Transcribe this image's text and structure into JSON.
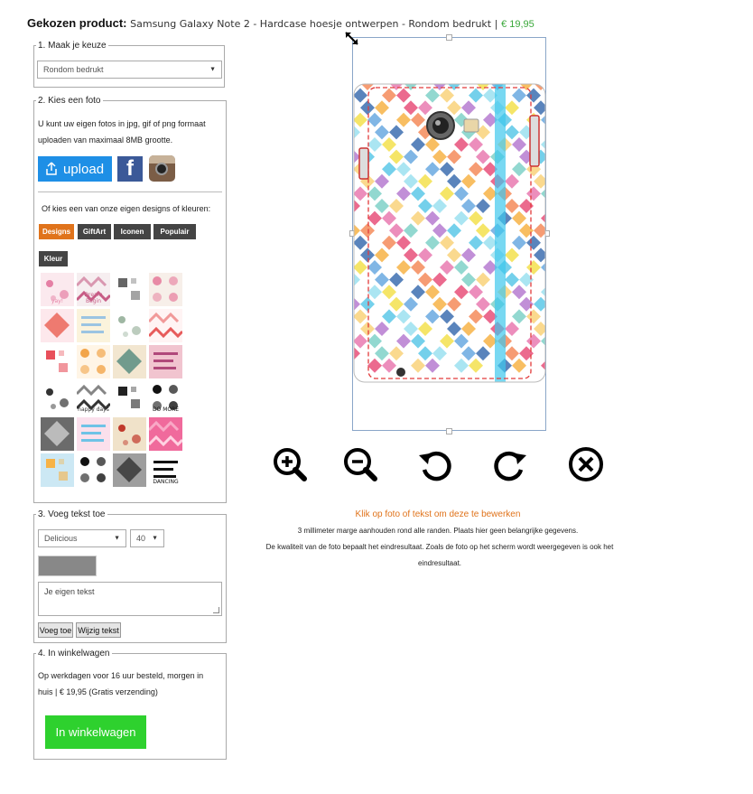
{
  "header": {
    "label": "Gekozen product:",
    "product": "Samsung Galaxy Note 2 - Hardcase hoesje ontwerpen - Rondom bedrukt",
    "separator": "|",
    "price": "€ 19,95"
  },
  "step1": {
    "legend": "1. Maak je keuze",
    "select_value": "Rondom bedrukt"
  },
  "step2": {
    "legend": "2. Kies een foto",
    "intro": "U kunt uw eigen fotos in jpg, gif of png formaat uploaden van maximaal 8MB grootte.",
    "upload_label": "upload",
    "facebook_letter": "f",
    "choose_text": "Of kies een van onze eigen designs of kleuren:",
    "tabs": [
      "Designs",
      "GiftArt",
      "Iconen",
      "Populair",
      "Kleur"
    ],
    "active_tab": "Designs",
    "thumbnails": [
      {
        "name": "yay",
        "text": "yay!",
        "bg": "#fbe9ee",
        "fg": "#e57fa4"
      },
      {
        "name": "dream-begin",
        "text": "Dream Begin",
        "bg": "#f6eef0",
        "fg": "#c75d86"
      },
      {
        "name": "deer",
        "text": "",
        "bg": "#ffffff",
        "fg": "#666"
      },
      {
        "name": "donuts",
        "text": "",
        "bg": "#f7efe9",
        "fg": "#e88aa5"
      },
      {
        "name": "flowers",
        "text": "",
        "bg": "#fde8ec",
        "fg": "#e74c3c"
      },
      {
        "name": "dots",
        "text": "",
        "bg": "#fbf3dc",
        "fg": "#9bc4e2"
      },
      {
        "name": "feathers",
        "text": "",
        "bg": "#ffffff",
        "fg": "#9fb7a3"
      },
      {
        "name": "ice-cream",
        "text": "",
        "bg": "#fff4f4",
        "fg": "#e75b5b"
      },
      {
        "name": "world-map",
        "text": "",
        "bg": "#ffffff",
        "fg": "#e8505b"
      },
      {
        "name": "ice-pops",
        "text": "",
        "bg": "#fff5e6",
        "fg": "#f2a54a"
      },
      {
        "name": "aztec",
        "text": "",
        "bg": "#f2e6d0",
        "fg": "#3b7b70"
      },
      {
        "name": "quote-pink",
        "text": "",
        "bg": "#f1c4cf",
        "fg": "#b0487a"
      },
      {
        "name": "glasses",
        "text": "",
        "bg": "#ffffff",
        "fg": "#333"
      },
      {
        "name": "happy-days",
        "text": "happy days",
        "bg": "#ffffff",
        "fg": "#333"
      },
      {
        "name": "triangles",
        "text": "",
        "bg": "#ffffff",
        "fg": "#222"
      },
      {
        "name": "do-more",
        "text": "DO MORE",
        "bg": "#ffffff",
        "fg": "#111"
      },
      {
        "name": "tiger",
        "text": "",
        "bg": "#6b6b6b",
        "fg": "#ddd"
      },
      {
        "name": "zigzag",
        "text": "",
        "bg": "#fbe0ec",
        "fg": "#6ec3e6"
      },
      {
        "name": "geo-red",
        "text": "",
        "bg": "#f0e2c9",
        "fg": "#c0392b"
      },
      {
        "name": "mandala",
        "text": "",
        "bg": "#f06a9c",
        "fg": "#ffd2e2"
      },
      {
        "name": "diamonds",
        "text": "",
        "bg": "#cce8f4",
        "fg": "#f7b347"
      },
      {
        "name": "quote-black",
        "text": "",
        "bg": "#ffffff",
        "fg": "#111"
      },
      {
        "name": "girl-bw",
        "text": "",
        "bg": "#9e9e9e",
        "fg": "#222"
      },
      {
        "name": "dancing",
        "text": "DANCING",
        "bg": "#ffffff",
        "fg": "#111"
      }
    ]
  },
  "step3": {
    "legend": "3. Voeg tekst toe",
    "font_value": "Delicious",
    "size_value": "40",
    "text_placeholder": "Je eigen tekst",
    "add_button": "Voeg toe",
    "edit_button": "Wijzig tekst"
  },
  "step4": {
    "legend": "4. In winkelwagen",
    "info": "Op werkdagen voor 16 uur besteld, morgen in huis | € 19,95 (Gratis verzending)",
    "cart_button": "In winkelwagen"
  },
  "messages": {
    "click_hint": "Klik op foto of tekst om deze te bewerken",
    "margin_note": "3 millimeter marge aanhouden rond alle randen. Plaats hier geen belangrijke gegevens.",
    "quality_note": "De kwaliteit van de foto bepaalt het eindresultaat. Zoals de foto op het scherm wordt weergegeven is ook het eindresultaat."
  },
  "tools": [
    "zoom-in-icon",
    "zoom-out-icon",
    "rotate-left-icon",
    "rotate-right-icon",
    "delete-icon"
  ],
  "colors": {
    "accent_orange": "#e0731b",
    "upload_blue": "#1e8fe6",
    "cart_green": "#2ed12e",
    "price_green": "#3aa83a"
  }
}
